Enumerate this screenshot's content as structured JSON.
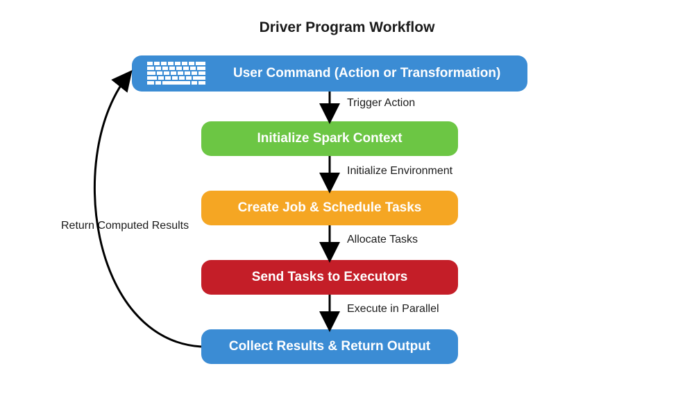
{
  "title": "Driver Program Workflow",
  "nodes": {
    "user_command": "User Command (Action or Transformation)",
    "init_context": "Initialize Spark Context",
    "create_job": "Create Job & Schedule Tasks",
    "send_tasks": "Send Tasks to Executors",
    "collect_results": "Collect Results & Return Output"
  },
  "edges": {
    "trigger_action": "Trigger Action",
    "init_env": "Initialize Environment",
    "allocate_tasks": "Allocate Tasks",
    "execute_parallel": "Execute in Parallel",
    "return_results": "Return Computed Results"
  },
  "icons": {
    "keyboard": "keyboard-icon"
  },
  "colors": {
    "blue": "#3b8cd4",
    "green": "#6cc644",
    "orange": "#f5a623",
    "red": "#c41e28"
  }
}
